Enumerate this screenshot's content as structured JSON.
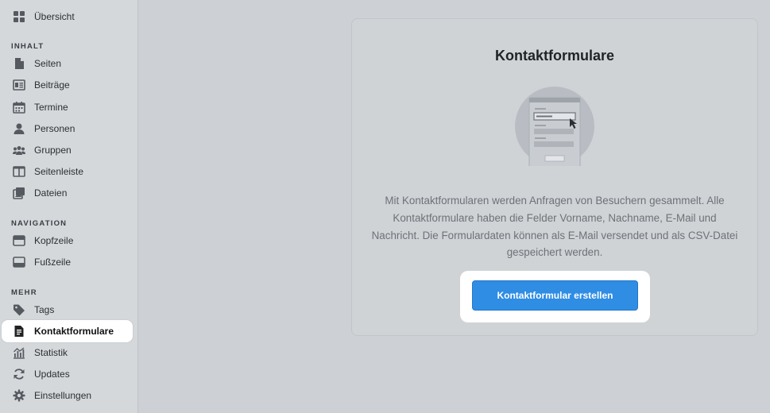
{
  "sidebar": {
    "top": [
      {
        "label": "Übersicht",
        "icon": "dashboard-icon"
      }
    ],
    "sections": [
      {
        "title": "INHALT",
        "items": [
          {
            "label": "Seiten",
            "icon": "page-icon"
          },
          {
            "label": "Beiträge",
            "icon": "posts-icon"
          },
          {
            "label": "Termine",
            "icon": "calendar-icon"
          },
          {
            "label": "Personen",
            "icon": "person-icon"
          },
          {
            "label": "Gruppen",
            "icon": "groups-icon"
          },
          {
            "label": "Seitenleiste",
            "icon": "sidebar-layout-icon"
          },
          {
            "label": "Dateien",
            "icon": "files-icon"
          }
        ]
      },
      {
        "title": "NAVIGATION",
        "items": [
          {
            "label": "Kopfzeile",
            "icon": "header-icon"
          },
          {
            "label": "Fußzeile",
            "icon": "footer-icon"
          }
        ]
      },
      {
        "title": "MEHR",
        "items": [
          {
            "label": "Tags",
            "icon": "tag-icon"
          },
          {
            "label": "Kontaktformulare",
            "icon": "form-document-icon",
            "active": true
          },
          {
            "label": "Statistik",
            "icon": "statistics-icon"
          },
          {
            "label": "Updates",
            "icon": "refresh-icon"
          },
          {
            "label": "Einstellungen",
            "icon": "gear-icon"
          }
        ]
      }
    ]
  },
  "main": {
    "title": "Kontaktformulare",
    "description": "Mit Kontaktformularen werden Anfragen von Besuchern gesammelt. Alle Kontaktformulare haben die Felder Vorname, Nachname, E-Mail und Nachricht. Die Formulardaten können als E-Mail versendet und als CSV-Datei gespeichert werden.",
    "create_button_label": "Kontaktformular erstellen",
    "illustration_icon": "contact-form-illustration"
  },
  "colors": {
    "overlay_background": "#cdd1d5",
    "primary_button": "#2f8de4",
    "highlight": "#ffffff"
  }
}
